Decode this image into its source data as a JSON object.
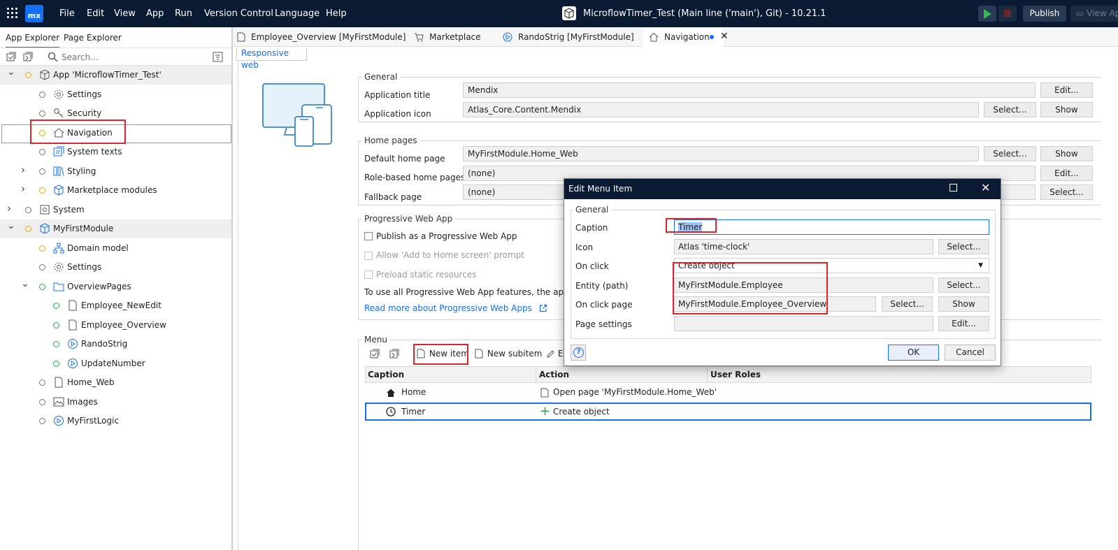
{
  "titlebar": {
    "menu": [
      "File",
      "Edit",
      "View",
      "App",
      "Run",
      "Version Control",
      "Language",
      "Help"
    ],
    "window_title": "MicroflowTimer_Test (Main line ('main'), Git)  -  10.21.1",
    "logo_text": "mx",
    "publish_label": "Publish",
    "view_app_label": "View Ap"
  },
  "left_panel": {
    "tabs": [
      "App Explorer",
      "Page Explorer"
    ],
    "search_placeholder": "Search...",
    "tree": [
      {
        "label": "App 'MicroflowTimer_Test'",
        "icon": "cube-icon",
        "dot": "o"
      },
      {
        "label": "Settings",
        "icon": "gear-icon",
        "dot": ""
      },
      {
        "label": "Security",
        "icon": "key-icon",
        "dot": ""
      },
      {
        "label": "Navigation",
        "icon": "home-icon",
        "dot": "o"
      },
      {
        "label": "System texts",
        "icon": "text-icon",
        "dot": ""
      },
      {
        "label": "Styling",
        "icon": "styling-icon",
        "dot": ""
      },
      {
        "label": "Marketplace modules",
        "icon": "module-icon",
        "dot": "o"
      },
      {
        "label": "System",
        "icon": "system-icon",
        "dot": ""
      },
      {
        "label": "MyFirstModule",
        "icon": "module-icon",
        "dot": "o"
      },
      {
        "label": "Domain model",
        "icon": "domain-model-icon",
        "dot": "o"
      },
      {
        "label": "Settings",
        "icon": "gear-icon",
        "dot": ""
      },
      {
        "label": "OverviewPages",
        "icon": "folder-icon",
        "dot": "g"
      },
      {
        "label": "Employee_NewEdit",
        "icon": "page-icon",
        "dot": "g"
      },
      {
        "label": "Employee_Overview",
        "icon": "page-icon",
        "dot": "g"
      },
      {
        "label": "RandoStrig",
        "icon": "microflow-icon",
        "dot": "g"
      },
      {
        "label": "UpdateNumber",
        "icon": "microflow-icon",
        "dot": "g"
      },
      {
        "label": "Home_Web",
        "icon": "page-icon",
        "dot": ""
      },
      {
        "label": "Images",
        "icon": "image-icon",
        "dot": ""
      },
      {
        "label": "MyFirstLogic",
        "icon": "microflow-icon",
        "dot": ""
      }
    ]
  },
  "doc_tabs": [
    {
      "label": "Employee_Overview [MyFirstModule]"
    },
    {
      "label": "Marketplace"
    },
    {
      "label": "RandoStrig [MyFirstModule]"
    },
    {
      "label": "Navigation"
    }
  ],
  "subtab": "Responsive web",
  "general": {
    "title": "General",
    "app_title_label": "Application title",
    "app_title_value": "Mendix",
    "app_icon_label": "Application icon",
    "app_icon_value": "Atlas_Core.Content.Mendix"
  },
  "home_pages": {
    "title": "Home pages",
    "default_label": "Default home page",
    "default_value": "MyFirstModule.Home_Web",
    "role_label": "Role-based home pages",
    "role_value": "(none)",
    "fallback_label": "Fallback page",
    "fallback_value": "(none)"
  },
  "pwa": {
    "title": "Progressive Web App",
    "publish": "Publish as a Progressive Web App",
    "allow": "Allow 'Add to Home screen' prompt",
    "preload": "Preload static resources",
    "note": "To use all Progressive Web App features, the app needs",
    "link": "Read more about Progressive Web Apps"
  },
  "menu_section": {
    "title": "Menu",
    "new_item": "New item",
    "new_subitem": "New subitem",
    "edit_partial": "E",
    "columns": [
      "Caption",
      "Action",
      "User Roles"
    ],
    "rows": [
      {
        "caption": "Home",
        "action": "Open page 'MyFirstModule.Home_Web'"
      },
      {
        "caption": "Timer",
        "action": "Create object"
      }
    ]
  },
  "buttons": {
    "edit": "Edit...",
    "select": "Select...",
    "show": "Show"
  },
  "dialog": {
    "title": "Edit Menu Item",
    "group": "General",
    "caption_label": "Caption",
    "caption_value": "Timer",
    "icon_label": "Icon",
    "icon_value": "Atlas 'time-clock'",
    "onclick_label": "On click",
    "onclick_value": "Create object",
    "entity_label": "Entity (path)",
    "entity_value": "MyFirstModule.Employee",
    "page_label": "On click page",
    "page_value": "MyFirstModule.Employee_Overview",
    "settings_label": "Page settings",
    "ok": "OK",
    "cancel": "Cancel"
  }
}
